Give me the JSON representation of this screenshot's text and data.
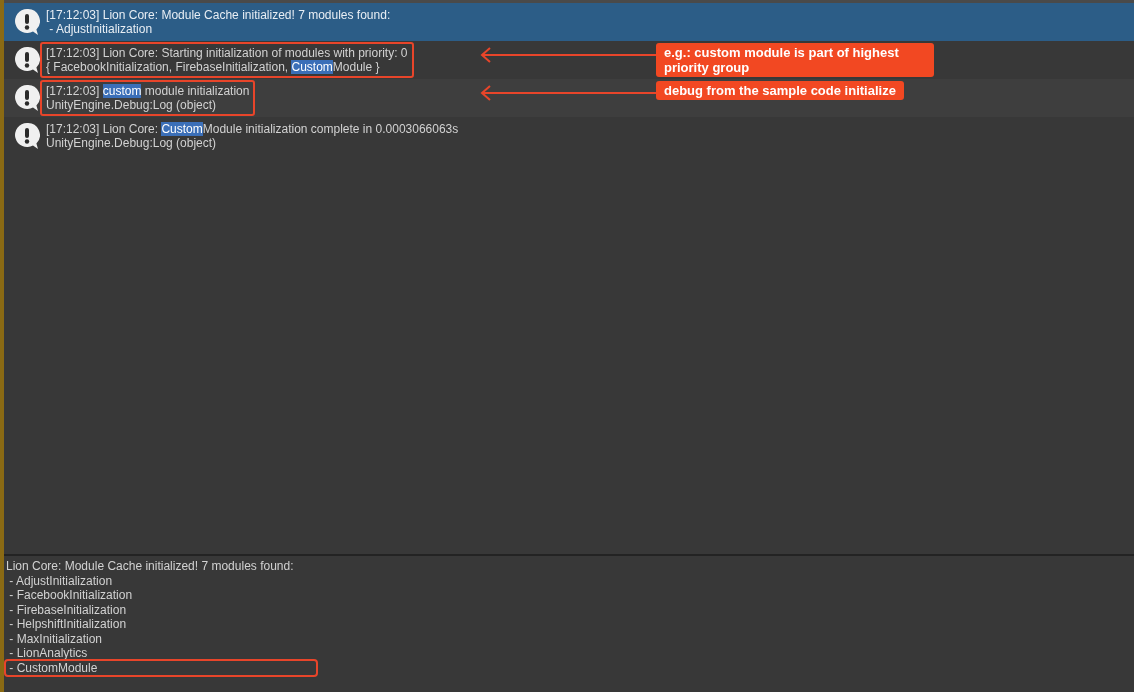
{
  "log_entries": [
    {
      "selected": true,
      "annotated": false,
      "lines": [
        [
          {
            "text": "[17:12:03] Lion Core: Module Cache initialized! 7 modules found:",
            "highlighted": false
          }
        ],
        [
          {
            "text": " - AdjustInitialization",
            "highlighted": false
          }
        ]
      ]
    },
    {
      "selected": false,
      "annotated": true,
      "callout": "e.g.: custom module is part of highest priority group",
      "lines": [
        [
          {
            "text": "[17:12:03] Lion Core: Starting initialization of modules with priority: 0",
            "highlighted": false
          }
        ],
        [
          {
            "text": "{ FacebookInitialization, FirebaseInitialization, ",
            "highlighted": false
          },
          {
            "text": "Custom",
            "highlighted": true
          },
          {
            "text": "Module }",
            "highlighted": false
          }
        ]
      ]
    },
    {
      "selected": false,
      "annotated": true,
      "callout": "debug from the sample code initialize",
      "lines": [
        [
          {
            "text": "[17:12:03] ",
            "highlighted": false
          },
          {
            "text": "custom",
            "highlighted": true
          },
          {
            "text": " module initialization",
            "highlighted": false
          }
        ],
        [
          {
            "text": "UnityEngine.Debug:Log (object)",
            "highlighted": false
          }
        ]
      ]
    },
    {
      "selected": false,
      "annotated": false,
      "lines": [
        [
          {
            "text": "[17:12:03] Lion Core: ",
            "highlighted": false
          },
          {
            "text": "Custom",
            "highlighted": true
          },
          {
            "text": "Module initialization complete in 0.0003066063s",
            "highlighted": false
          }
        ],
        [
          {
            "text": "UnityEngine.Debug:Log (object)",
            "highlighted": false
          }
        ]
      ]
    }
  ],
  "detail_panel": {
    "lines": [
      {
        "text": "Lion Core: Module Cache initialized! 7 modules found:",
        "annotated": false
      },
      {
        "text": " - AdjustInitialization",
        "annotated": false
      },
      {
        "text": " - FacebookInitialization",
        "annotated": false
      },
      {
        "text": " - FirebaseInitialization",
        "annotated": false
      },
      {
        "text": " - HelpshiftInitialization",
        "annotated": false
      },
      {
        "text": " - MaxInitialization",
        "annotated": false
      },
      {
        "text": " - LionAnalytics",
        "annotated": false
      },
      {
        "text": " - CustomModule",
        "annotated": true
      }
    ]
  }
}
